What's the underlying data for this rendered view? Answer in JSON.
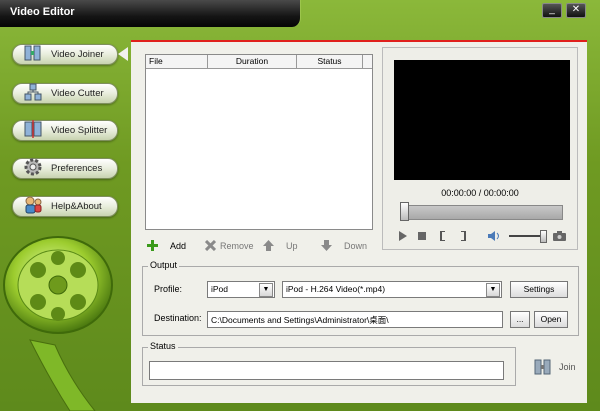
{
  "window": {
    "title": "Video Editor",
    "minimize": "_",
    "close": "✕"
  },
  "sidebar": {
    "items": [
      {
        "label": "Video Joiner",
        "icon": "joiner-icon"
      },
      {
        "label": "Video Cutter",
        "icon": "cutter-icon"
      },
      {
        "label": "Video Splitter",
        "icon": "splitter-icon"
      },
      {
        "label": "Preferences",
        "icon": "gear-icon"
      },
      {
        "label": "Help&About",
        "icon": "help-icon"
      }
    ]
  },
  "filelist": {
    "columns": [
      "File",
      "Duration",
      "Status"
    ]
  },
  "toolbar": {
    "add": "Add",
    "remove": "Remove",
    "up": "Up",
    "down": "Down"
  },
  "preview": {
    "time": "00:00:00 / 00:00:00"
  },
  "output": {
    "group": "Output",
    "profile_label": "Profile:",
    "profile_value": "iPod",
    "format_value": "iPod - H.264 Video(*.mp4)",
    "settings": "Settings",
    "destination_label": "Destination:",
    "destination_value": "C:\\Documents and Settings\\Administrator\\桌面\\",
    "browse": "...",
    "open": "Open"
  },
  "status": {
    "group": "Status",
    "value": ""
  },
  "join": {
    "label": "Join"
  },
  "colors": {
    "accent": "#e0201c",
    "frame": "#6f9a22"
  }
}
